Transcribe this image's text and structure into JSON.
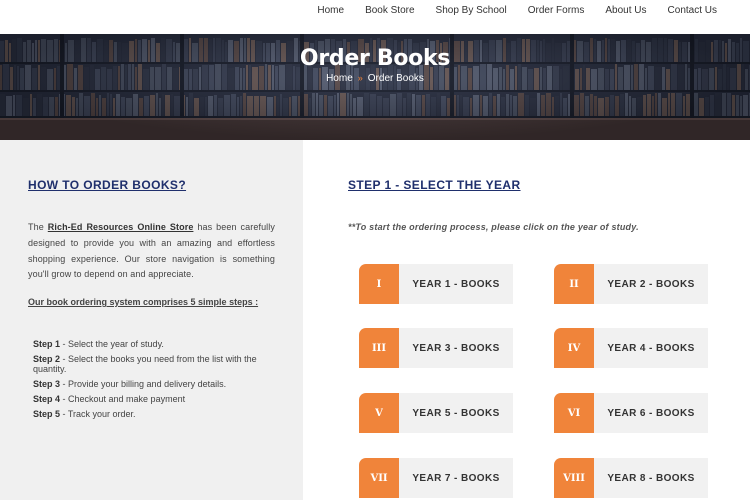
{
  "nav": {
    "items": [
      "Home",
      "Book Store",
      "Shop By School",
      "Order Forms",
      "About Us",
      "Contact Us"
    ]
  },
  "hero": {
    "title": "Order Books",
    "breadcrumb": {
      "home": "Home",
      "separator": "»",
      "current": "Order Books"
    }
  },
  "left": {
    "heading": "HOW TO ORDER BOOKS?",
    "intro_prefix": "The ",
    "store_name": "Rich-Ed Resources Online Store",
    "intro_rest": " has been carefully designed to provide you with an amazing and effortless shopping experience. Our store navigation is something you'll grow to depend on and appreciate.",
    "system_line": "Our book ordering system comprises 5 simple steps :",
    "steps": [
      {
        "label": "Step 1",
        "text": " - Select the year of study."
      },
      {
        "label": "Step 2",
        "text": " - Select the books you need from the list with the quantity."
      },
      {
        "label": "Step 3",
        "text": " - Provide your billing and delivery details."
      },
      {
        "label": "Step 4",
        "text": " - Checkout and make payment"
      },
      {
        "label": "Step 5",
        "text": " - Track your order."
      }
    ]
  },
  "right": {
    "heading": "STEP 1 - SELECT THE YEAR",
    "instruction": "**To start the ordering process, please click on the year of study.",
    "years": [
      {
        "roman": "I",
        "label": "YEAR 1 - BOOKS"
      },
      {
        "roman": "II",
        "label": "YEAR 2 - BOOKS"
      },
      {
        "roman": "III",
        "label": "YEAR 3 - BOOKS"
      },
      {
        "roman": "IV",
        "label": "YEAR 4 - BOOKS"
      },
      {
        "roman": "V",
        "label": "YEAR 5 - BOOKS"
      },
      {
        "roman": "VI",
        "label": "YEAR 6 - BOOKS"
      },
      {
        "roman": "VII",
        "label": "YEAR 7 - BOOKS"
      },
      {
        "roman": "VIII",
        "label": "YEAR 8 - BOOKS"
      }
    ]
  },
  "colors": {
    "accent": "#f0843a",
    "heading": "#1f2f6c",
    "panel": "#f0f0f0",
    "hero": "#23293a"
  }
}
